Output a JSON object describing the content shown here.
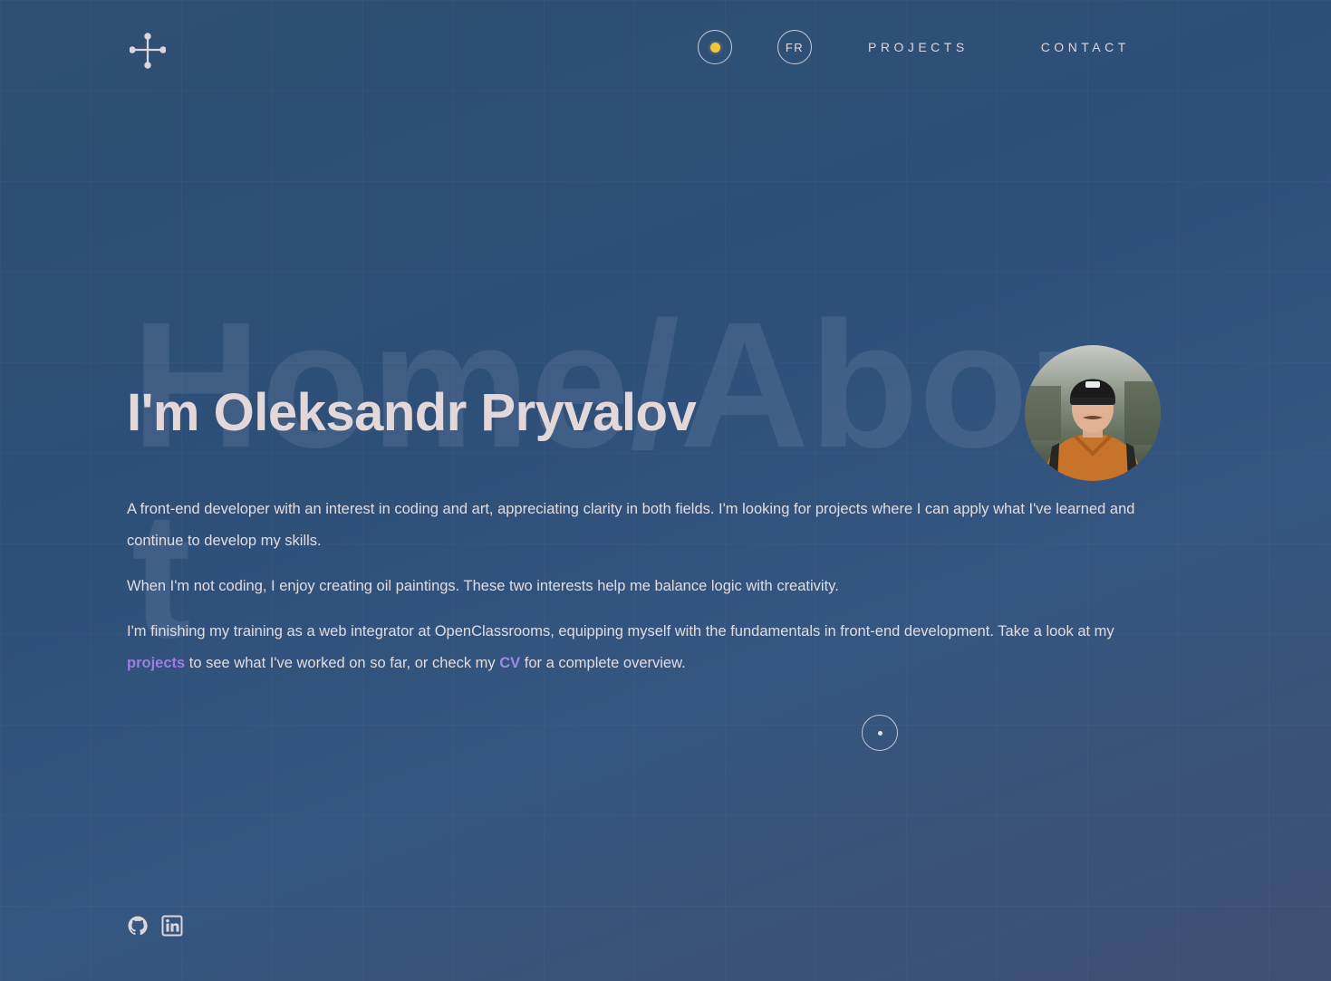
{
  "nav": {
    "theme_icon": "sun-icon",
    "lang_label": "FR",
    "projects_label": "PROJECTS",
    "contact_label": "CONTACT"
  },
  "hero": {
    "background_word": "Home/About",
    "title": "I'm Oleksandr Pryvalov",
    "paragraph1": "A front-end developer with an interest in coding and art, appreciating clarity in both fields. I'm looking for projects where I can apply what I've learned and continue to develop my skills.",
    "paragraph2": "When I'm not coding, I enjoy creating oil paintings. These two interests help me balance logic with creativity.",
    "paragraph3_before": "I'm finishing my training as a web integrator at OpenClassrooms, equipping myself with the fundamentals in front-end development. Take a look at my ",
    "projects_link": "projects",
    "paragraph3_middle": " to see what I've worked on so far, or check my ",
    "cv_link": "CV",
    "paragraph3_after": " for a complete overview."
  },
  "socials": {
    "github_icon": "github-icon",
    "linkedin_icon": "linkedin-icon"
  },
  "colors": {
    "background_top": "#2f4f73",
    "background_bottom": "#3f4f72",
    "text": "#e1dcdf",
    "title": "#e2d7d9",
    "link_projects": "#a07be0",
    "link_cv": "#9a8be6",
    "sun": "#f5c542"
  }
}
